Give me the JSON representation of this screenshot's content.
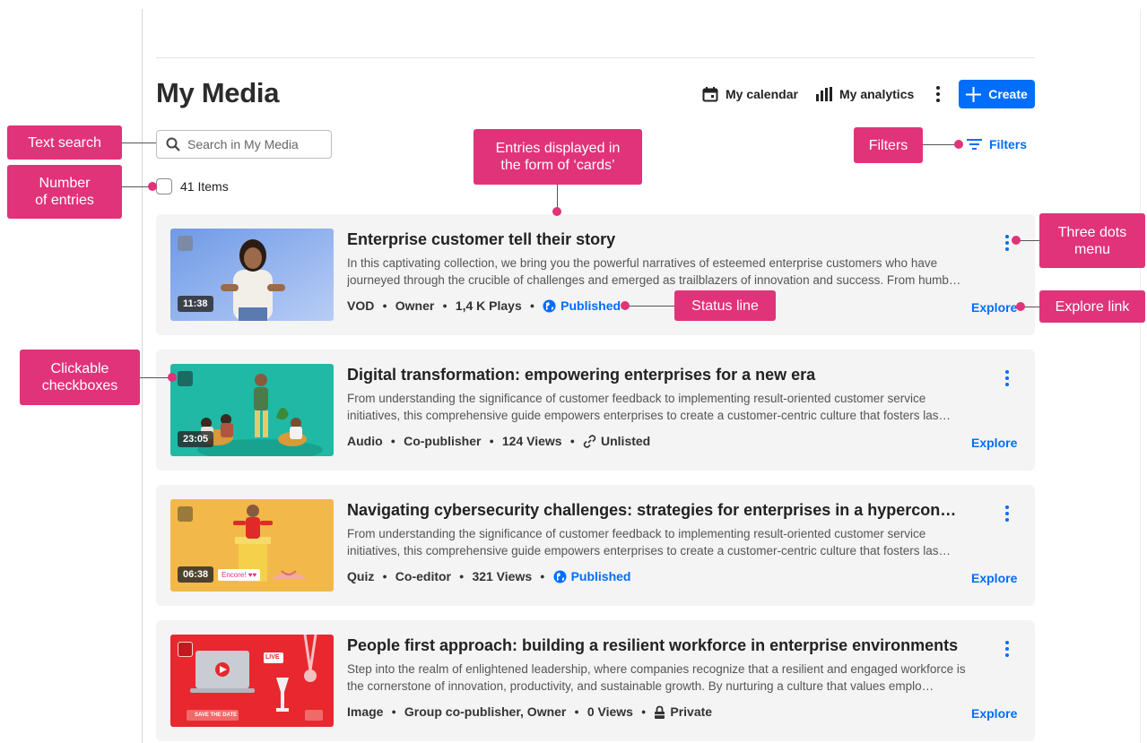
{
  "page": {
    "title": "My Media"
  },
  "header": {
    "calendar_label": "My calendar",
    "analytics_label": "My analytics",
    "create_label": "Create"
  },
  "search": {
    "placeholder": "Search in My Media"
  },
  "filters": {
    "label": "Filters"
  },
  "list": {
    "count_label": "41 Items"
  },
  "entries": [
    {
      "title": "Enterprise customer tell their story",
      "description": "In this captivating collection, we bring you the powerful narratives of esteemed enterprise customers who have journeyed through the crucible of challenges and emerged as trailblazers of innovation and success. From humb…",
      "duration": "11:38",
      "type": "VOD",
      "role": "Owner",
      "stat": "1,4 K Plays",
      "status": "Published",
      "status_icon": "globe-icon",
      "explore_label": "Explore"
    },
    {
      "title": "Digital transformation: empowering enterprises for a new era",
      "description": "From understanding the significance of customer feedback to implementing result-oriented customer service initiatives, this comprehensive guide empowers enterprises to create a customer-centric culture that fosters las…",
      "duration": "23:05",
      "type": "Audio",
      "role": "Co-publisher",
      "stat": "124 Views",
      "status": "Unlisted",
      "status_icon": "link-icon",
      "explore_label": "Explore"
    },
    {
      "title": "Navigating cybersecurity challenges: strategies for enterprises in a hyperconnected…",
      "description": "From understanding the significance of customer feedback to implementing result-oriented customer service initiatives, this comprehensive guide empowers enterprises to create a customer-centric culture that fosters las…",
      "duration": "06:38",
      "thumb_tag": "Encore! ♥♥",
      "type": "Quiz",
      "role": "Co-editor",
      "stat": "321 Views",
      "status": "Published",
      "status_icon": "globe-icon",
      "explore_label": "Explore"
    },
    {
      "title": "People first approach: building a resilient workforce in enterprise environments",
      "description": "Step into the realm of enlightened leadership, where companies recognize that a resilient and engaged workforce is the cornerstone of innovation, productivity, and sustainable growth. By nurturing a culture that values emplo…",
      "thumb_live": "LIVE",
      "thumb_banner": "SAVE THE DATE",
      "type": "Image",
      "role": "Group co-publisher, Owner",
      "stat": "0 Views",
      "status": "Private",
      "status_icon": "lock-icon",
      "explore_label": "Explore"
    }
  ],
  "annotations": {
    "text_search": "Text search",
    "number_of_entries": "Number\nof entries",
    "cards": "Entries displayed in\nthe form of ‘cards’",
    "filters": "Filters",
    "three_dots": "Three dots\nmenu",
    "status_line": "Status line",
    "explore_link": "Explore link",
    "checkboxes": "Clickable\ncheckboxes"
  },
  "colors": {
    "accent": "#006efa",
    "callout": "#e0337a",
    "card_bg": "#f4f4f4"
  }
}
